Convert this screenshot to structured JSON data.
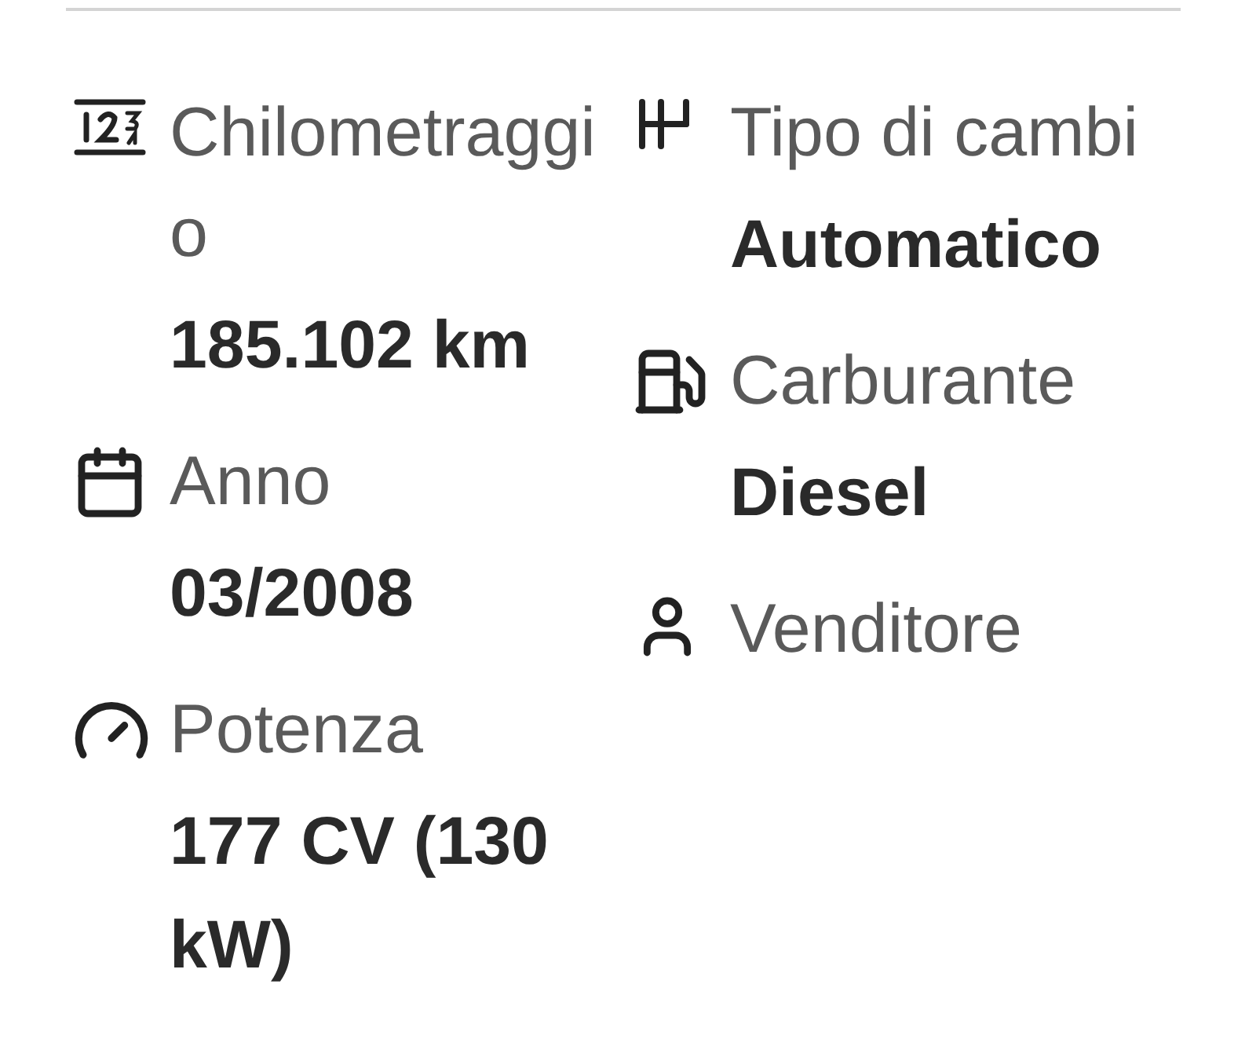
{
  "columns": [
    {
      "items": [
        {
          "label": "Chilometraggio",
          "value": "185.102 km"
        },
        {
          "label": "Anno",
          "value": "03/2008"
        },
        {
          "label": "Potenza",
          "value": "177 CV (130 kW)"
        }
      ]
    },
    {
      "items": [
        {
          "label": "Tipo di cambi",
          "value": "Automatico"
        },
        {
          "label": "Carburante",
          "value": "Diesel"
        },
        {
          "label": "Venditore"
        }
      ]
    }
  ]
}
